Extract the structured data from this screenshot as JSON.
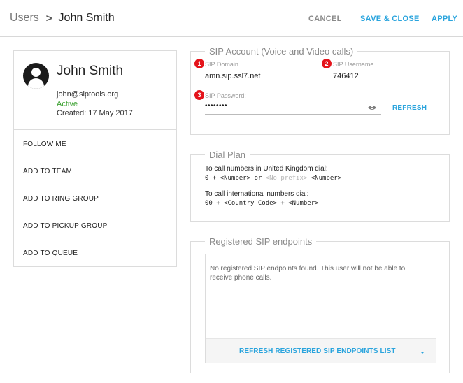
{
  "header": {
    "breadcrumb_parent": "Users",
    "breadcrumb_separator": ">",
    "breadcrumb_current": "John Smith",
    "cancel_label": "CANCEL",
    "save_close_label": "SAVE & CLOSE",
    "apply_label": "APPLY"
  },
  "user": {
    "name": "John Smith",
    "email": "john@siptools.org",
    "status": "Active",
    "created": "Created: 17 May 2017",
    "avatar_icon": "account-circle-icon"
  },
  "actions": [
    {
      "label": "FOLLOW ME"
    },
    {
      "label": "ADD TO TEAM"
    },
    {
      "label": "ADD TO RING GROUP"
    },
    {
      "label": "ADD TO PICKUP GROUP"
    },
    {
      "label": "ADD TO QUEUE"
    }
  ],
  "sip_account": {
    "legend": "SIP Account (Voice and Video calls)",
    "domain_label": "SIP Domain",
    "domain_value": "amn.sip.ssl7.net",
    "domain_badge": "1",
    "username_label": "SIP Username",
    "username_value": "746412",
    "username_badge": "2",
    "password_label": "SIP Password:",
    "password_value": "••••••••",
    "password_badge": "3",
    "refresh_label": "REFRESH"
  },
  "dial_plan": {
    "legend": "Dial Plan",
    "uk_heading": "To call numbers in United Kingdom dial:",
    "uk_rule_prefix": "0 + <Number> or ",
    "uk_rule_faded": "<No prefix>",
    "uk_rule_suffix": " <Number>",
    "intl_heading": "To call international numbers dial:",
    "intl_rule": "00 + <Country Code> + <Number>"
  },
  "endpoints": {
    "legend": "Registered SIP endpoints",
    "empty_message": "No registered SIP endpoints found. This user will not be able to receive phone calls.",
    "refresh_label": "REFRESH REGISTERED SIP ENDPOINTS LIST"
  },
  "colors": {
    "accent": "#2aa4dd",
    "status_active": "#39a02e",
    "badge": "#e4141b"
  }
}
